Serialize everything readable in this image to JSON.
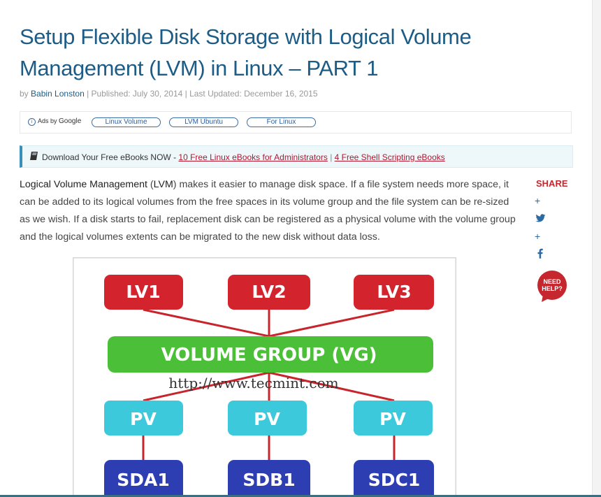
{
  "article": {
    "title": "Setup Flexible Disk Storage with Logical Volume Management (LVM) in Linux – PART 1",
    "by": "by ",
    "author": "Babin Lonston",
    "published": " | Published: July 30, 2014 | Last Updated: December 16, 2015"
  },
  "ads": {
    "ads_by": "Ads by ",
    "google": "Google",
    "chips": [
      "Linux Volume",
      "LVM Ubuntu",
      "For Linux"
    ]
  },
  "ebook_bar": {
    "icon": "book-icon",
    "text": "Download Your Free eBooks NOW - ",
    "link1": "10 Free Linux eBooks for Administrators",
    "separator": " | ",
    "link2": "4 Free Shell Scripting eBooks"
  },
  "intro": {
    "bold1": "Logical Volume Management",
    "mid": " (",
    "bold2": "LVM",
    "rest": ") makes it easier to manage disk space. If a file system needs more space, it can be added to its logical volumes from the free spaces in its volume group and the file system can be re-sized as we wish. If a disk starts to fail, replacement disk can be registered as a physical volume with the volume group and the logical volumes extents can be migrated to the new disk without data loss."
  },
  "share": {
    "label": "SHARE",
    "plus": "+",
    "icons": [
      "plus-icon",
      "twitter-icon",
      "plus-icon",
      "facebook-icon"
    ],
    "need_help": [
      "NEED",
      "HELP?"
    ]
  },
  "diagram": {
    "lv": [
      "LV1",
      "LV2",
      "LV3"
    ],
    "vg": "VOLUME GROUP (VG)",
    "watermark": "http://www.tecmint.com",
    "pv": [
      "PV",
      "PV",
      "PV"
    ],
    "disks": [
      "SDA1",
      "SDB1",
      "SDC1"
    ]
  },
  "colors": {
    "title": "#1d5c86",
    "link": "#b4152d",
    "share": "#c6262d",
    "lv": "#d3232c",
    "vg": "#4cbf39",
    "pv": "#3dc9dc",
    "disk": "#2d3db2"
  }
}
